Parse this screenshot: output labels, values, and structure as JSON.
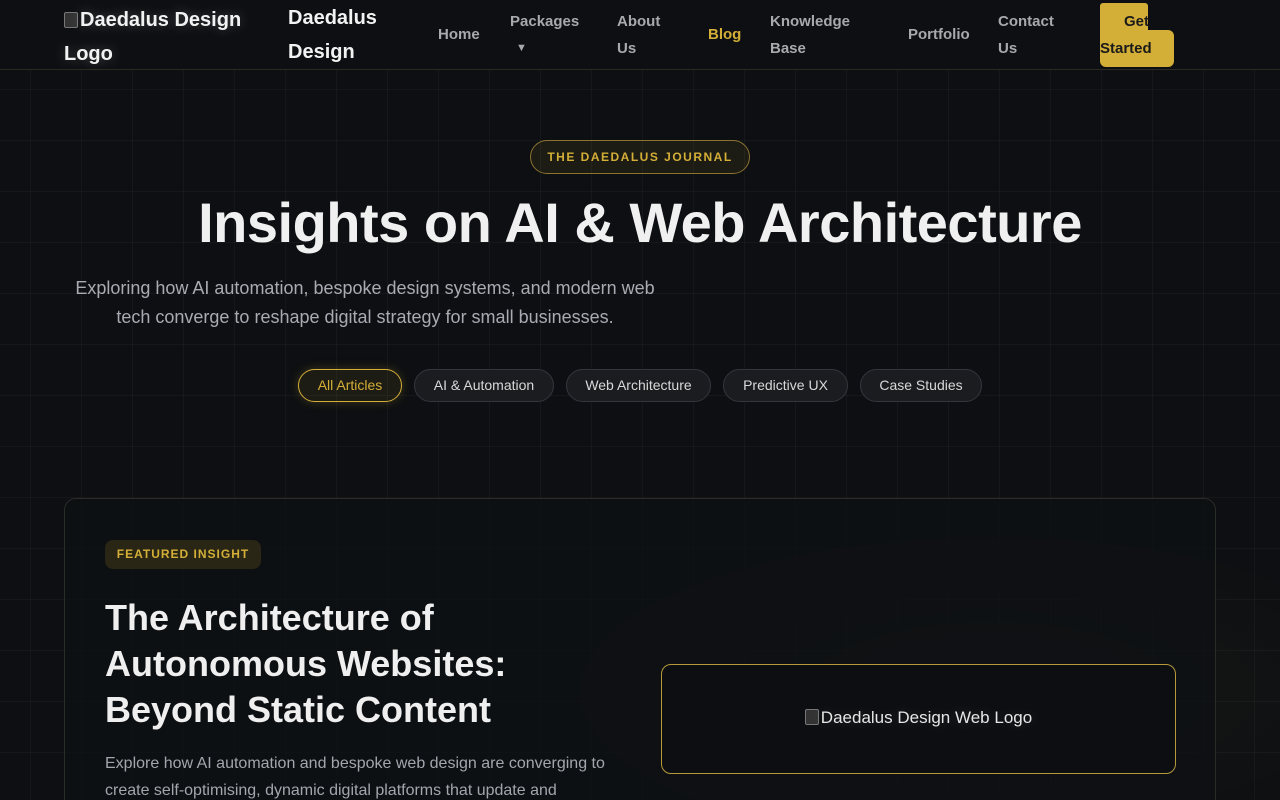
{
  "header": {
    "logo_alt": "Daedalus Design Logo",
    "brand_name": "Daedalus Design",
    "nav": [
      {
        "label": "Home"
      },
      {
        "label": "Packages",
        "caret": "▼"
      },
      {
        "label": "About Us"
      },
      {
        "label": "Blog",
        "active": true
      },
      {
        "label": "Knowledge Base"
      },
      {
        "label": "Portfolio"
      },
      {
        "label": "Contact Us"
      }
    ],
    "cta": {
      "line1": "Get",
      "line2": "Started"
    }
  },
  "hero": {
    "eyebrow": "THE DAEDALUS JOURNAL",
    "title": "Insights on AI & Web Architecture",
    "subtitle": "Exploring how AI automation, bespoke design systems, and modern web tech converge to reshape digital strategy for small businesses."
  },
  "filters": [
    {
      "label": "All Articles",
      "active": true
    },
    {
      "label": "AI & Automation"
    },
    {
      "label": "Web Architecture"
    },
    {
      "label": "Predictive UX"
    },
    {
      "label": "Case Studies"
    }
  ],
  "featured": {
    "badge": "FEATURED INSIGHT",
    "title": "The Architecture of Autonomous Websites: Beyond Static Content",
    "excerpt": "Explore how AI automation and bespoke web design are converging to create self-optimising, dynamic digital platforms that update and",
    "image_alt": "Daedalus Design Web Logo"
  },
  "colors": {
    "background": "#0d0f12",
    "accent": "#d4af37",
    "muted_text": "#a8abb2"
  }
}
